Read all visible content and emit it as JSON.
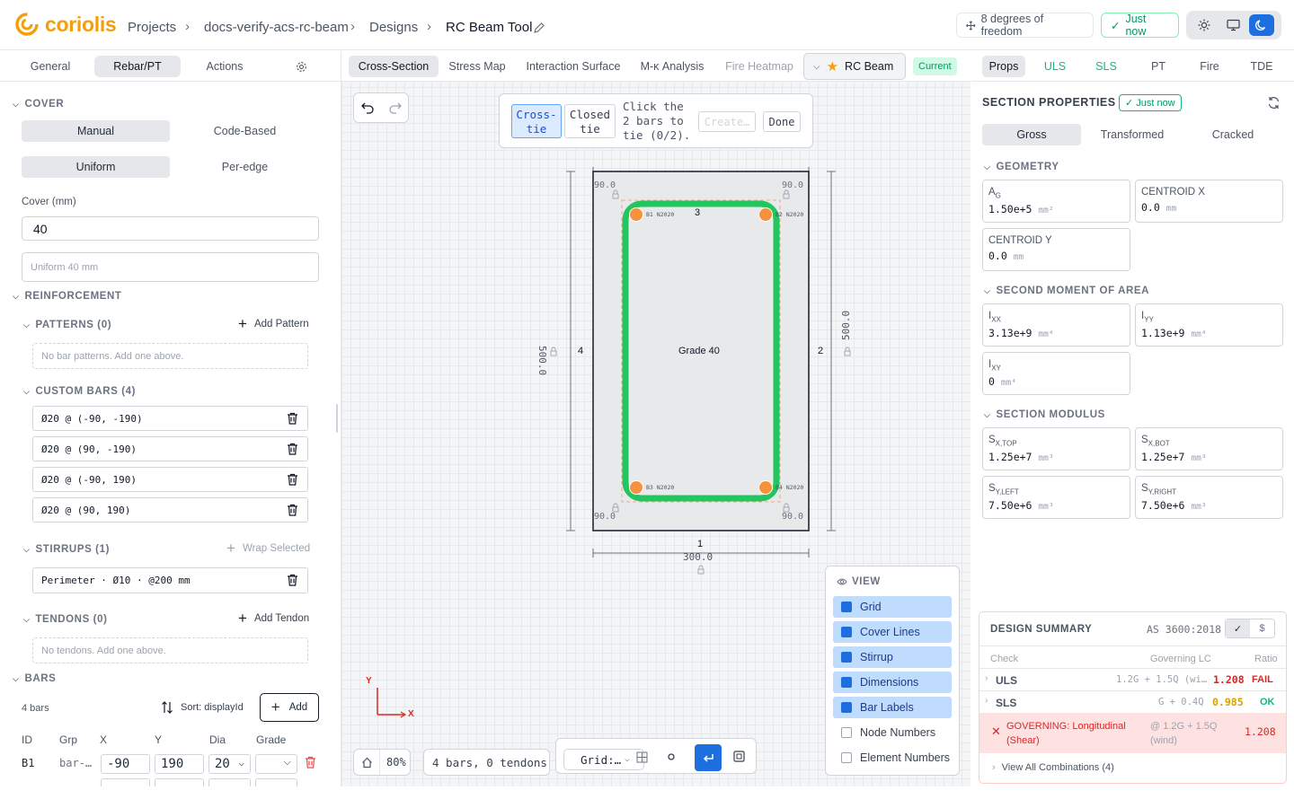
{
  "header": {
    "logo_text": "coriolis",
    "crumbs": [
      "Projects",
      "docs-verify-acs-rc-beam",
      "Designs",
      "RC Beam Tool"
    ],
    "dof_label": "8 degrees of freedom",
    "saved_label": "Just now"
  },
  "left": {
    "tabs": [
      "General",
      "Rebar/PT",
      "Actions"
    ],
    "cover": {
      "title": "COVER",
      "mode": [
        "Manual",
        "Code-Based"
      ],
      "edge": [
        "Uniform",
        "Per-edge"
      ],
      "cover_label": "Cover (mm)",
      "cover_value": "40",
      "summary": "Uniform 40 mm"
    },
    "reinforcement": {
      "title": "REINFORCEMENT",
      "patterns_title": "PATTERNS (0)",
      "add_pattern": "Add Pattern",
      "patterns_empty": "No bar patterns. Add one above.",
      "custom_title": "CUSTOM BARS (4)",
      "custom_bars": [
        "Ø20 @ (-90, -190)",
        "Ø20 @ (90, -190)",
        "Ø20 @ (-90, 190)",
        "Ø20 @ (90, 190)"
      ],
      "stirrups_title": "STIRRUPS (1)",
      "wrap_selected": "Wrap Selected",
      "stirrup": "Perimeter · Ø10 · @200 mm",
      "tendons_title": "TENDONS (0)",
      "add_tendon": "Add Tendon",
      "tendons_empty": "No tendons. Add one above."
    },
    "bars": {
      "title": "BARS",
      "count": "4 bars",
      "sort": "Sort: displayId",
      "add": "Add",
      "columns": [
        "ID",
        "Grp",
        "X",
        "Y",
        "Dia",
        "Grade"
      ],
      "row1": {
        "id": "B1",
        "grp": "bar-…",
        "x": "-90",
        "y": "190",
        "dia": "20"
      }
    }
  },
  "center": {
    "tabs": [
      "Cross-Section",
      "Stress Map",
      "Interaction Surface",
      "M-κ Analysis",
      "Fire Heatmap"
    ],
    "design_name": "RC Beam",
    "design_status": "Current",
    "tie": {
      "cross": "Cross-tie",
      "closed": "Closed tie",
      "instruction": "Click the 2 bars to tie (0/2).",
      "create": "Create…",
      "done": "Done"
    },
    "section": {
      "grade": "Grade 40",
      "edge_top": "3",
      "edge_right": "2",
      "edge_bottom": "1",
      "edge_left": "4",
      "width_dim": "300.0",
      "height_left": "500.0",
      "height_right": "500.0",
      "corner_cover": "90.0",
      "bar_labels": [
        "B1 N2020",
        "B2 N2020",
        "B3 N2020",
        "B4 N2020"
      ]
    },
    "axes": {
      "y": "Y",
      "x": "X"
    },
    "view": {
      "title": "VIEW",
      "items": [
        "Grid",
        "Cover Lines",
        "Stirrup",
        "Dimensions",
        "Bar Labels",
        "Node Numbers",
        "Element Numbers"
      ]
    },
    "status": {
      "zoom": "80%",
      "summary": "4 bars, 0 tendons",
      "grid": "Grid:…"
    }
  },
  "right": {
    "tabs": [
      "Props",
      "ULS",
      "SLS",
      "PT",
      "Fire",
      "TDE"
    ],
    "section_props_title": "SECTION PROPERTIES",
    "just_now": "Just now",
    "basis": [
      "Gross",
      "Transformed",
      "Cracked"
    ],
    "geometry_title": "GEOMETRY",
    "ag_value": "1.50e+5",
    "ag_unit": "mm²",
    "cx_label": "CENTROID X",
    "cx_value": "0.0",
    "cy_label": "CENTROID Y",
    "cy_value": "0.0",
    "mm": "mm",
    "second_title": "SECOND MOMENT OF AREA",
    "ixx": "3.13e+9",
    "iyy": "1.13e+9",
    "ixy": "0",
    "mm4": "mm⁴",
    "modulus_title": "SECTION MODULUS",
    "sxtop": "1.25e+7",
    "sxbot": "1.25e+7",
    "syleft": "7.50e+6",
    "syright": "7.50e+6",
    "mm3": "mm³",
    "design": {
      "title": "DESIGN SUMMARY",
      "code": "AS 3600:2018",
      "col_check": "Check",
      "col_lc": "Governing LC",
      "col_ratio": "Ratio",
      "uls_name": "ULS",
      "uls_lc": "1.2G + 1.5Q (wi…",
      "uls_ratio": "1.208",
      "uls_status": "FAIL",
      "sls_name": "SLS",
      "sls_lc": "G + 0.4Q",
      "sls_ratio": "0.985",
      "sls_status": "OK",
      "gov_text": "GOVERNING: Longitudinal (Shear)",
      "gov_lc": "@ 1.2G + 1.5Q (wind)",
      "gov_ratio": "1.208",
      "view_all": "View All Combinations (4)"
    }
  },
  "colors": {
    "accent": "#1d6fe0",
    "ok": "#10b981",
    "fail": "#dc2626",
    "stirrup": "#22c55e",
    "bar": "#f5923e",
    "brand": "#f59e0b"
  }
}
